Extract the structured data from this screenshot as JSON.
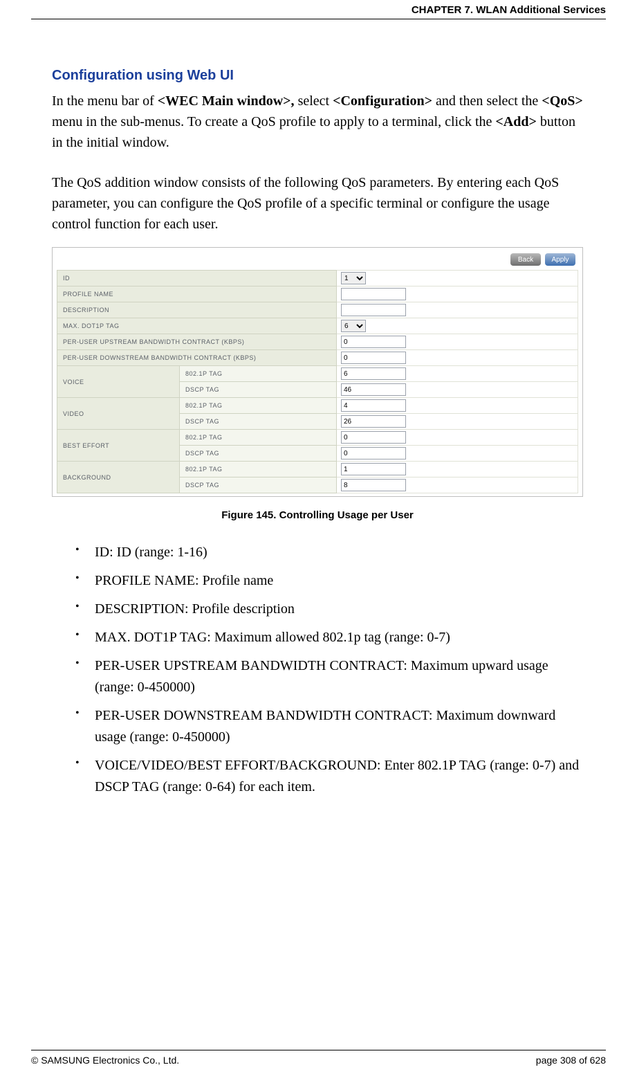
{
  "header": {
    "chapter": "CHAPTER 7. WLAN Additional Services"
  },
  "section": {
    "title": "Configuration using Web UI"
  },
  "para1": {
    "a": "In the menu bar of ",
    "b": "<WEC Main window>,",
    "c": " select ",
    "d": "<Configuration>",
    "e": " and then select the ",
    "f": "<QoS>",
    "g": " menu in the sub-menus. To create a QoS profile to apply to a terminal, click the ",
    "h": "<Add>",
    "i": " button in the initial window."
  },
  "para2": "The QoS addition window consists of the following QoS parameters. By entering each QoS parameter, you can configure the QoS profile of a specific terminal or configure the usage control function for each user.",
  "figure": {
    "buttons": {
      "back": "Back",
      "apply": "Apply"
    },
    "rows": {
      "id": {
        "label": "ID",
        "value": "1"
      },
      "profile": {
        "label": "PROFILE NAME",
        "value": ""
      },
      "desc": {
        "label": "DESCRIPTION",
        "value": ""
      },
      "maxdot": {
        "label": "MAX. DOT1P TAG",
        "value": "6"
      },
      "up": {
        "label": "PER-USER UPSTREAM BANDWIDTH CONTRACT (KBPS)",
        "value": "0"
      },
      "down": {
        "label": "PER-USER DOWNSTREAM BANDWIDTH CONTRACT (KBPS)",
        "value": "0"
      }
    },
    "groups": {
      "voice": {
        "label": "VOICE",
        "dot1p_label": "802.1P TAG",
        "dot1p": "6",
        "dscp_label": "DSCP TAG",
        "dscp": "46"
      },
      "video": {
        "label": "VIDEO",
        "dot1p_label": "802.1P TAG",
        "dot1p": "4",
        "dscp_label": "DSCP TAG",
        "dscp": "26"
      },
      "best": {
        "label": "BEST EFFORT",
        "dot1p_label": "802.1P TAG",
        "dot1p": "0",
        "dscp_label": "DSCP TAG",
        "dscp": "0"
      },
      "back": {
        "label": "BACKGROUND",
        "dot1p_label": "802.1P TAG",
        "dot1p": "1",
        "dscp_label": "DSCP TAG",
        "dscp": "8"
      }
    },
    "caption": "Figure 145. Controlling Usage per User"
  },
  "bullets": [
    "ID: ID (range: 1-16)",
    "PROFILE NAME: Profile name",
    "DESCRIPTION: Profile description",
    "MAX. DOT1P TAG: Maximum allowed 802.1p tag (range: 0-7)",
    "PER-USER UPSTREAM BANDWIDTH CONTRACT: Maximum upward usage (range: 0-450000)",
    "PER-USER DOWNSTREAM BANDWIDTH CONTRACT: Maximum downward usage (range: 0-450000)",
    "VOICE/VIDEO/BEST EFFORT/BACKGROUND: Enter 802.1P TAG (range: 0-7) and DSCP TAG (range: 0-64) for each item."
  ],
  "footer": {
    "copyright": "© SAMSUNG Electronics Co., Ltd.",
    "pager": "page 308 of 628"
  }
}
